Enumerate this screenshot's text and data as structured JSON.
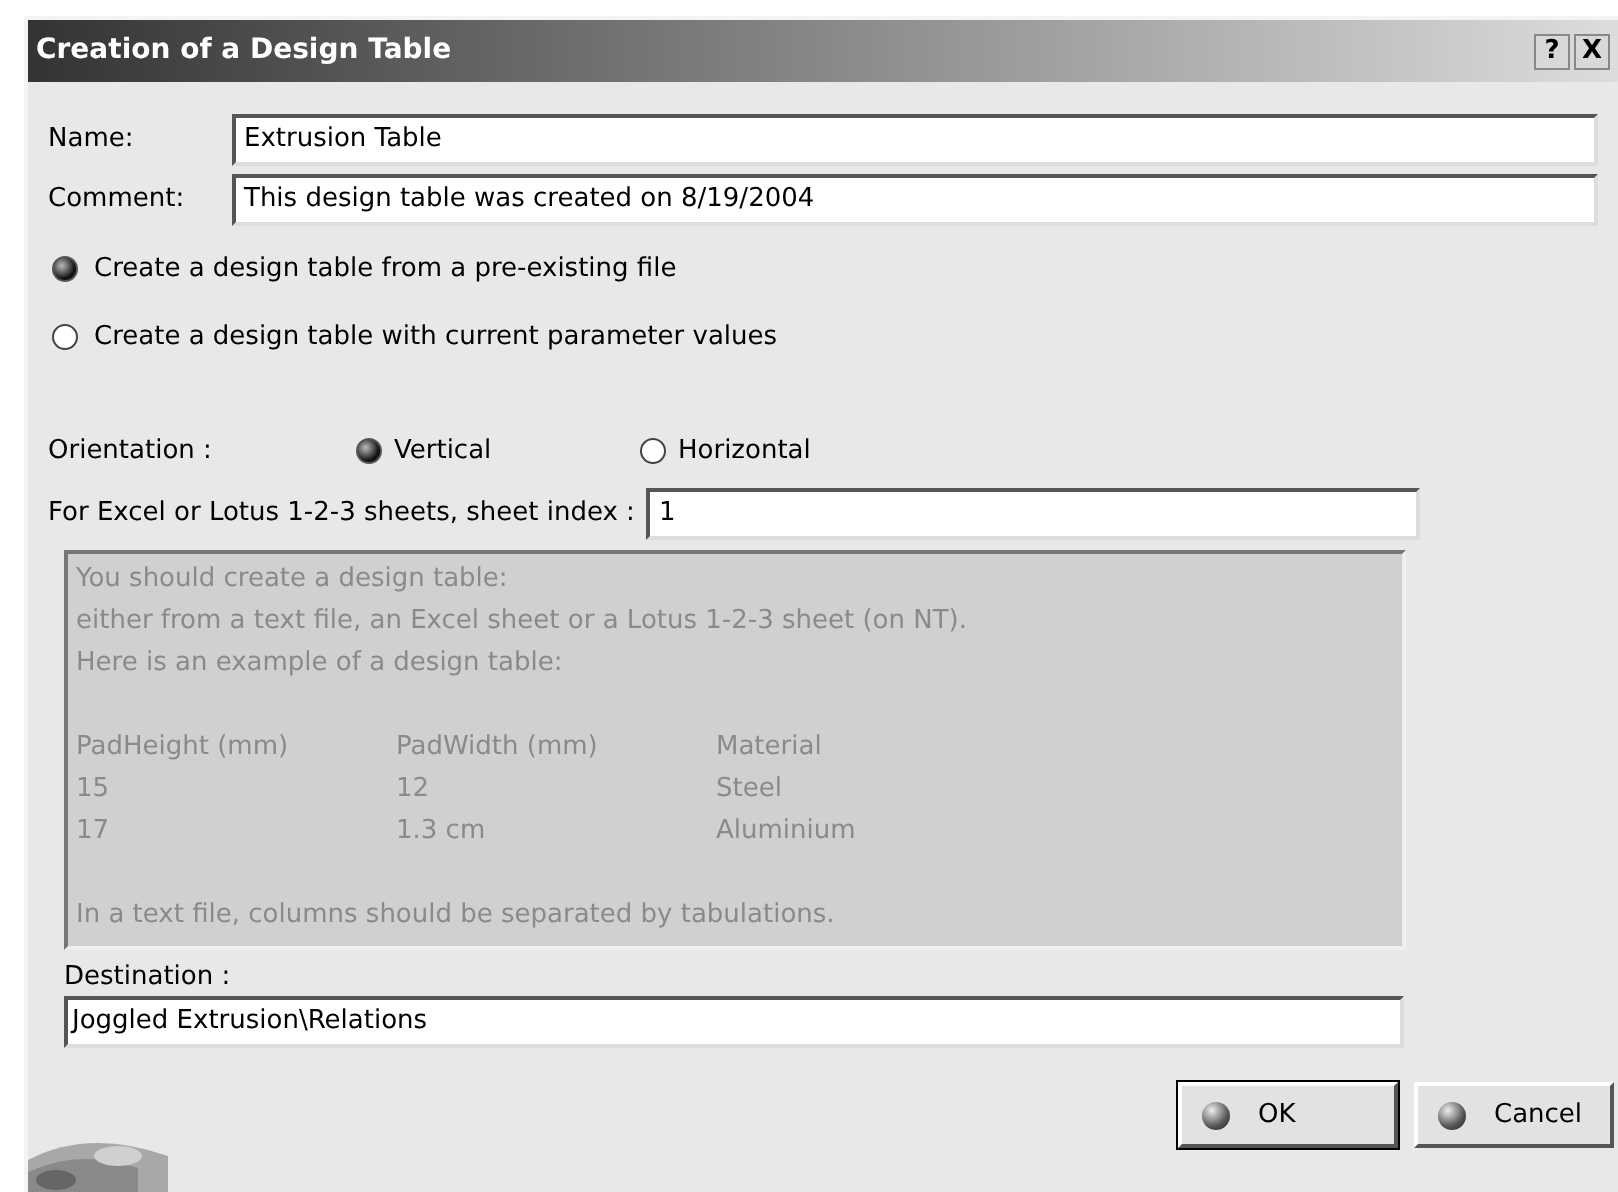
{
  "window": {
    "title": "Creation of a Design Table",
    "title_buttons": [
      "?",
      "X"
    ]
  },
  "fields": [
    {
      "label": "Name:",
      "value": "Extrusion Table"
    },
    {
      "label": "Comment:",
      "value": "This design table was created on 8/19/2004"
    }
  ],
  "source_options": [
    {
      "label": "Create a design table from a pre-existing file",
      "selected": true
    },
    {
      "label": "Create a design table with current parameter values",
      "selected": false
    }
  ],
  "orientation": {
    "label": "Orientation :",
    "options": [
      {
        "label": "Vertical",
        "selected": true
      },
      {
        "label": "Horizontal",
        "selected": false
      }
    ]
  },
  "sheet_index": {
    "label": "For Excel or Lotus 1-2-3 sheets, sheet index :",
    "value": "1"
  },
  "info": {
    "lines": [
      "You should create a design table:",
      "either from a text file, an Excel sheet or a Lotus 1-2-3 sheet (on NT).",
      "Here is an example of a design table:"
    ],
    "example_rows": [
      [
        "PadHeight (mm)",
        "PadWidth (mm)",
        "Material"
      ],
      [
        "15",
        "12",
        "Steel"
      ],
      [
        "17",
        "1.3 cm",
        "Aluminium"
      ]
    ],
    "footer": "In a text file, columns should be separated by tabulations."
  },
  "destination": {
    "label": "Destination :",
    "value": "Joggled Extrusion\\Relations"
  },
  "buttons": [
    {
      "label": "OK",
      "default": true
    },
    {
      "label": "Cancel",
      "default": false
    }
  ]
}
